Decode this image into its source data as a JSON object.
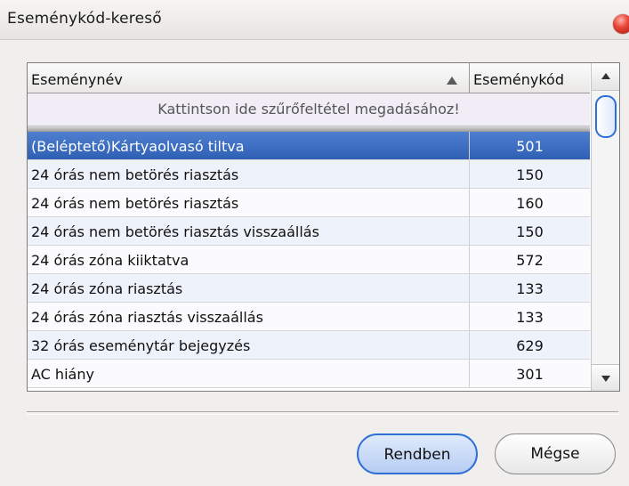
{
  "window": {
    "title": "Eseménykód-kereső"
  },
  "grid": {
    "columns": {
      "name": "Eseménynév",
      "code": "Eseménykód"
    },
    "filter_hint": "Kattintson ide szűrőfeltétel megadásához!",
    "rows": [
      {
        "name": "(Beléptető)Kártyaolvasó  tiltva",
        "code": "501",
        "selected": true
      },
      {
        "name": "24 órás nem betörés riasztás",
        "code": "150"
      },
      {
        "name": "24 órás nem betörés riasztás",
        "code": "160"
      },
      {
        "name": "24 órás nem betörés riasztás visszaállás",
        "code": "150"
      },
      {
        "name": "24 órás zóna kiiktatva",
        "code": "572"
      },
      {
        "name": "24 órás zóna riasztás",
        "code": "133"
      },
      {
        "name": "24 órás zóna riasztás visszaállás",
        "code": "133"
      },
      {
        "name": "32 órás eseménytár bejegyzés",
        "code": "629"
      },
      {
        "name": "AC hiány",
        "code": "301"
      }
    ]
  },
  "buttons": {
    "ok": "Rendben",
    "cancel": "Mégse"
  },
  "colors": {
    "selection": "#3566bd",
    "primary_button_border": "#2f6fd6",
    "close_button": "#e8473a"
  },
  "icons": {
    "close": "close-icon",
    "sort": "sort-ascending-icon",
    "scroll_up": "arrow-up-icon",
    "scroll_down": "arrow-down-icon"
  }
}
